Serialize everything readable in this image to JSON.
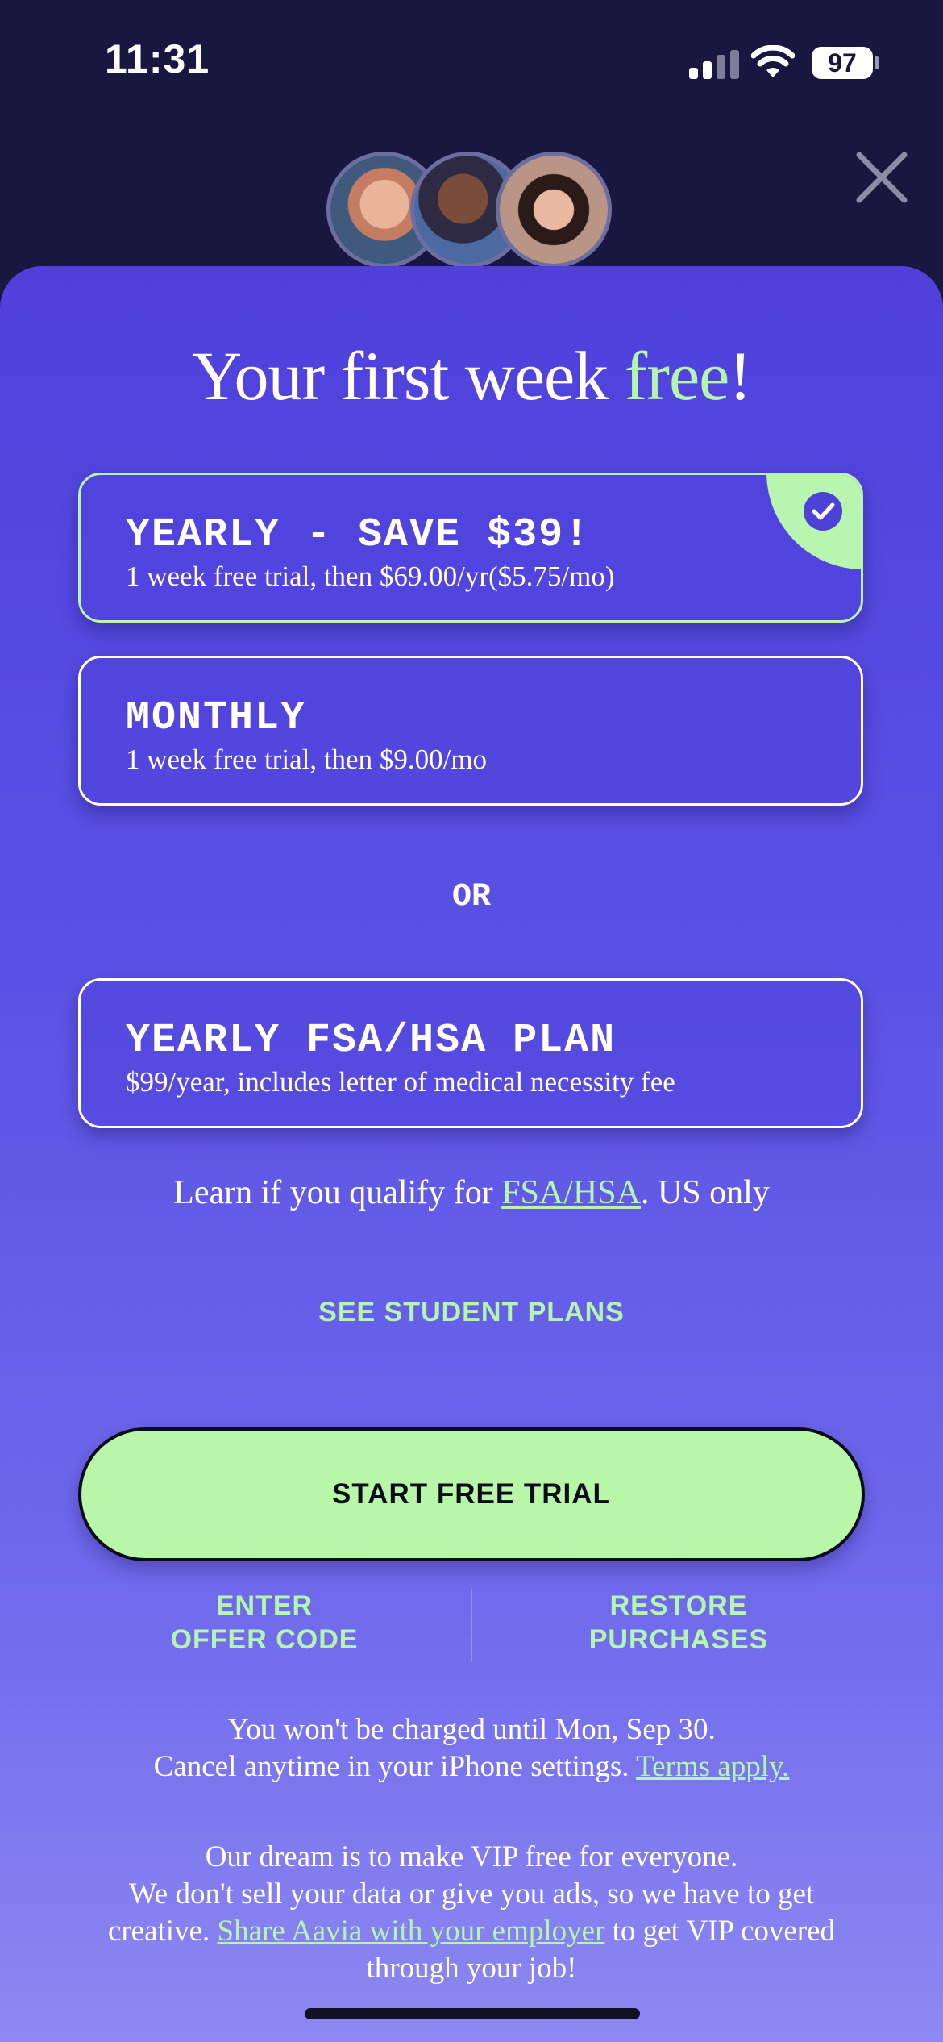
{
  "status_bar": {
    "time": "11:31",
    "battery": "97"
  },
  "header": {
    "avatars": [
      "user-photo-1",
      "user-photo-2",
      "user-photo-3"
    ],
    "close_icon": "close-icon"
  },
  "headline": {
    "main": "Your first week ",
    "accent": "free",
    "end": "!"
  },
  "plans": [
    {
      "title": "YEARLY - SAVE $39!",
      "subtitle": "1 week free trial, then $69.00/yr($5.75/mo)",
      "selected": true
    },
    {
      "title": "MONTHLY",
      "subtitle": "1 week free trial, then $9.00/mo",
      "selected": false
    }
  ],
  "or_label": "OR",
  "fsa_plan": {
    "title": "YEARLY FSA/HSA PLAN",
    "subtitle": "$99/year, includes letter of medical necessity fee"
  },
  "learn": {
    "before": "Learn if you qualify for ",
    "link": "FSA/HSA",
    "after": ". US only"
  },
  "student_plans": "SEE STUDENT PLANS",
  "cta": "START FREE TRIAL",
  "secondary": {
    "offer_line1": "ENTER",
    "offer_line2": "OFFER CODE",
    "restore_line1": "RESTORE",
    "restore_line2": "PURCHASES"
  },
  "billing": {
    "line1": "You won't be charged until Mon, Sep 30.",
    "line2_before": "Cancel anytime in your iPhone settings. ",
    "line2_link": "Terms apply."
  },
  "mission": {
    "line1": "Our  dream is to make VIP free for everyone.",
    "line2": "We don't sell your data or give you ads, so we have to get",
    "line3_before": "creative. ",
    "line3_link": "Share Aavia with your employer",
    "line3_after": " to get VIP covered",
    "line4": "through your job!"
  },
  "colors": {
    "accent": "#b6f5ad",
    "cta_bg": "#b8f7a8",
    "sheet_top": "#4f40dc",
    "sheet_bottom": "#8e88f2"
  }
}
